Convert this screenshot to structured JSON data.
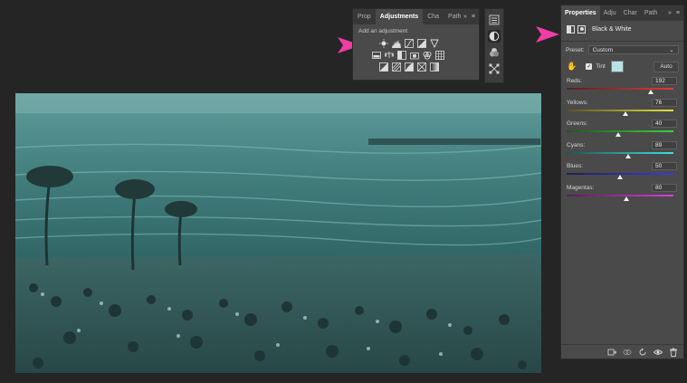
{
  "adjustments_panel": {
    "tabs": [
      "Prop",
      "Adjustments",
      "Cha",
      "Path"
    ],
    "active_tab": 1,
    "hint": "Add an adjustment",
    "menu_glyph": "≡",
    "expand_glyph": "»",
    "icon_rows": [
      [
        "brightness-contrast-icon",
        "levels-icon",
        "curves-icon",
        "exposure-icon",
        "vibrance-icon"
      ],
      [
        "hue-saturation-icon",
        "color-balance-icon",
        "black-white-icon",
        "photo-filter-icon",
        "channel-mixer-icon",
        "color-lookup-icon"
      ],
      [
        "invert-icon",
        "posterize-icon",
        "threshold-icon",
        "selective-color-icon",
        "gradient-map-icon"
      ]
    ]
  },
  "toolstrip": {
    "icons": [
      "properties-icon",
      "adjustments-icon",
      "layers-styles-icon",
      "paths-icon"
    ],
    "selected": 1
  },
  "properties_panel": {
    "tabs": [
      "Properties",
      "Adju",
      "Char",
      "Path"
    ],
    "active_tab": 0,
    "expand_glyph": "»",
    "menu_glyph": "≡",
    "title": "Black & White",
    "preset_label": "Preset:",
    "preset_value": "Custom",
    "tint_label": "Tint",
    "tint_checked": true,
    "tint_color": "#b8e2e4",
    "auto_label": "Auto",
    "sliders": [
      {
        "label": "Reds:",
        "value": "192",
        "level": 192,
        "gradient": [
          "#552020",
          "#e03a3a"
        ]
      },
      {
        "label": "Yellows:",
        "value": "76",
        "level": 76,
        "gradient": [
          "#545420",
          "#e6e23a"
        ]
      },
      {
        "label": "Greens:",
        "value": "40",
        "level": 40,
        "gradient": [
          "#205420",
          "#3ad23a"
        ]
      },
      {
        "label": "Cyans:",
        "value": "89",
        "level": 89,
        "gradient": [
          "#205454",
          "#3ae0e0"
        ]
      },
      {
        "label": "Blues:",
        "value": "50",
        "level": 50,
        "gradient": [
          "#202054",
          "#3a3ae0"
        ]
      },
      {
        "label": "Magentas:",
        "value": "80",
        "level": 80,
        "gradient": [
          "#542054",
          "#e03ae0"
        ]
      }
    ],
    "slider_range": [
      -200,
      300
    ],
    "footer_icons": [
      "clip-to-layer-icon",
      "view-previous-icon",
      "reset-icon",
      "visibility-icon",
      "trash-icon"
    ]
  },
  "colors": {
    "pointer": "#ef3ea6",
    "photo_tint": "#4a8f8d"
  }
}
